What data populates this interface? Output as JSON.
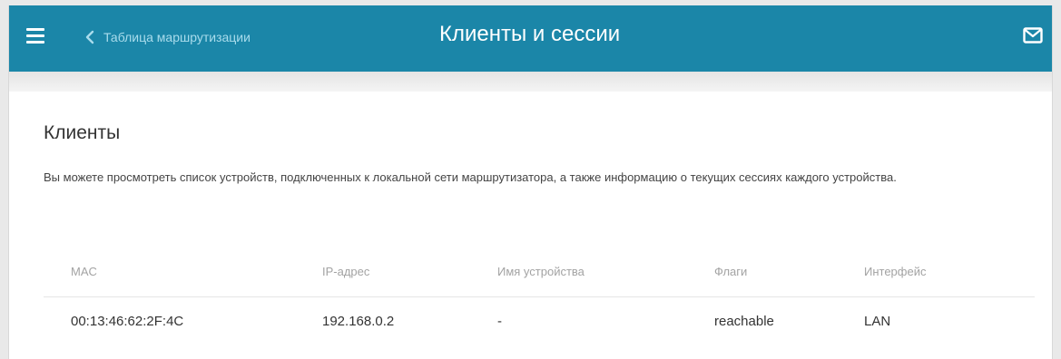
{
  "header": {
    "back_label": "Таблица маршрутизации",
    "title": "Клиенты и сессии"
  },
  "section": {
    "title": "Клиенты",
    "description": "Вы можете просмотреть список устройств, подключенных к локальной сети маршрутизатора, а также информацию о текущих сессиях каждого устройства."
  },
  "table": {
    "columns": [
      "MAC",
      "IP-адрес",
      "Имя устройства",
      "Флаги",
      "Интерфейс"
    ],
    "rows": [
      [
        "00:13:46:62:2F:4C",
        "192.168.0.2",
        "-",
        "reachable",
        "LAN"
      ]
    ]
  },
  "colors": {
    "topbar": "#1b86a8",
    "back_link": "#a9dcec"
  },
  "icons": {
    "menu": "hamburger-menu-icon",
    "back": "chevron-left-icon",
    "notifications": "envelope-icon"
  }
}
